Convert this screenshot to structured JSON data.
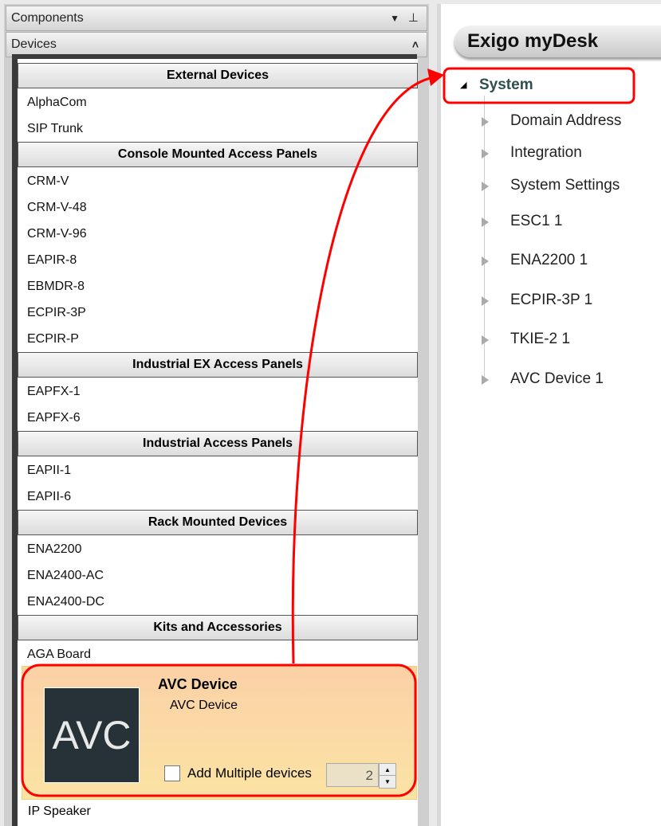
{
  "panel": {
    "title": "Components",
    "section": "Devices"
  },
  "list": [
    {
      "type": "header",
      "label": "External Devices"
    },
    {
      "type": "item",
      "label": "AlphaCom"
    },
    {
      "type": "item",
      "label": "SIP Trunk"
    },
    {
      "type": "header",
      "label": "Console Mounted Access Panels"
    },
    {
      "type": "item",
      "label": "CRM-V"
    },
    {
      "type": "item",
      "label": "CRM-V-48"
    },
    {
      "type": "item",
      "label": "CRM-V-96"
    },
    {
      "type": "item",
      "label": "EAPIR-8"
    },
    {
      "type": "item",
      "label": "EBMDR-8"
    },
    {
      "type": "item",
      "label": "ECPIR-3P"
    },
    {
      "type": "item",
      "label": "ECPIR-P"
    },
    {
      "type": "header",
      "label": "Industrial EX Access Panels"
    },
    {
      "type": "item",
      "label": "EAPFX-1"
    },
    {
      "type": "item",
      "label": "EAPFX-6"
    },
    {
      "type": "header",
      "label": "Industrial Access Panels"
    },
    {
      "type": "item",
      "label": "EAPII-1"
    },
    {
      "type": "item",
      "label": "EAPII-6"
    },
    {
      "type": "header",
      "label": "Rack Mounted Devices"
    },
    {
      "type": "item",
      "label": "ENA2200"
    },
    {
      "type": "item",
      "label": "ENA2400-AC"
    },
    {
      "type": "item",
      "label": "ENA2400-DC"
    },
    {
      "type": "header",
      "label": "Kits and Accessories"
    },
    {
      "type": "item",
      "label": "AGA Board"
    }
  ],
  "selected": {
    "logo": "AVC",
    "title": "AVC Device",
    "subtitle": "AVC Device",
    "checkbox_label": "Add Multiple devices",
    "checked": false,
    "count": "2"
  },
  "after": {
    "label": "IP Speaker"
  },
  "right": {
    "title": "Exigo myDesk",
    "root": "System",
    "children": [
      "Domain Address",
      "Integration",
      "System Settings",
      "ESC1 1",
      "ENA2200 1",
      "ECPIR-3P 1",
      "TKIE-2 1",
      "AVC Device 1"
    ]
  },
  "colors": {
    "annotation": "#ff0000"
  }
}
